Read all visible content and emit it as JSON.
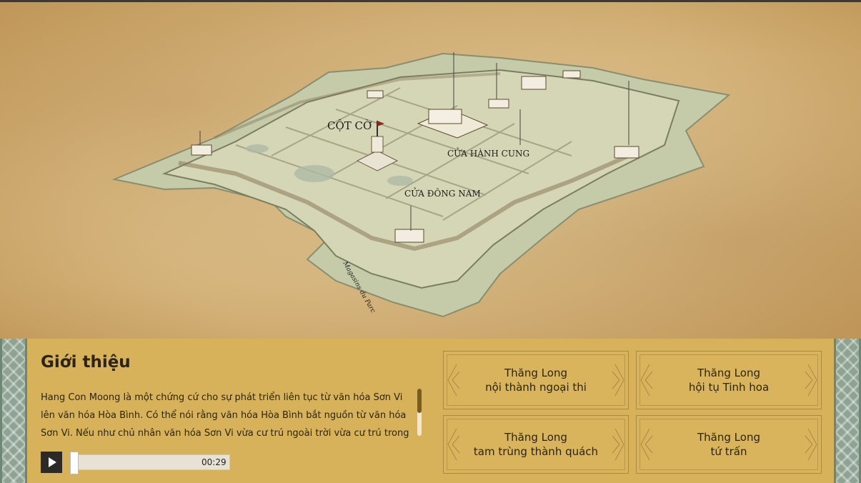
{
  "map": {
    "labels": {
      "cot_co": "CỘT CỜ",
      "cua_hanh_cung": "CỬA HÀNH CUNG",
      "cua_dong_nam": "CỬA ĐÔNG NAM",
      "magasins": "Magasins du Parc"
    }
  },
  "intro": {
    "title": "Giới thiệu",
    "text": "Hang Con Moong là một chứng cứ cho sự phát triển liên tục từ văn hóa Sơn Vi lên văn hóa Hòa Bình. Có thể nói rằng văn hóa Hòa Bình bắt nguồn từ văn hóa Sơn Vi. Nếu như chủ nhân văn hóa Sơn Vi vừa cư trú ngoài trời vừa cư trú trong hang động",
    "scroll_position": 0
  },
  "audio": {
    "play_icon": "play-icon",
    "time": "00:29",
    "progress": 0
  },
  "cards": [
    {
      "line1": "Thăng Long",
      "line2": "nội thành ngoại thi"
    },
    {
      "line1": "Thăng Long",
      "line2": "hội tụ Tinh hoa"
    },
    {
      "line1": "Thăng Long",
      "line2": "tam trùng thành quách"
    },
    {
      "line1": "Thăng Long",
      "line2": "tứ trấn"
    }
  ],
  "colors": {
    "panel": "#d8b25a",
    "side_pattern": "#8fa394",
    "map_paper": "#d8b981",
    "citadel_fill": "#c9ccaa"
  }
}
